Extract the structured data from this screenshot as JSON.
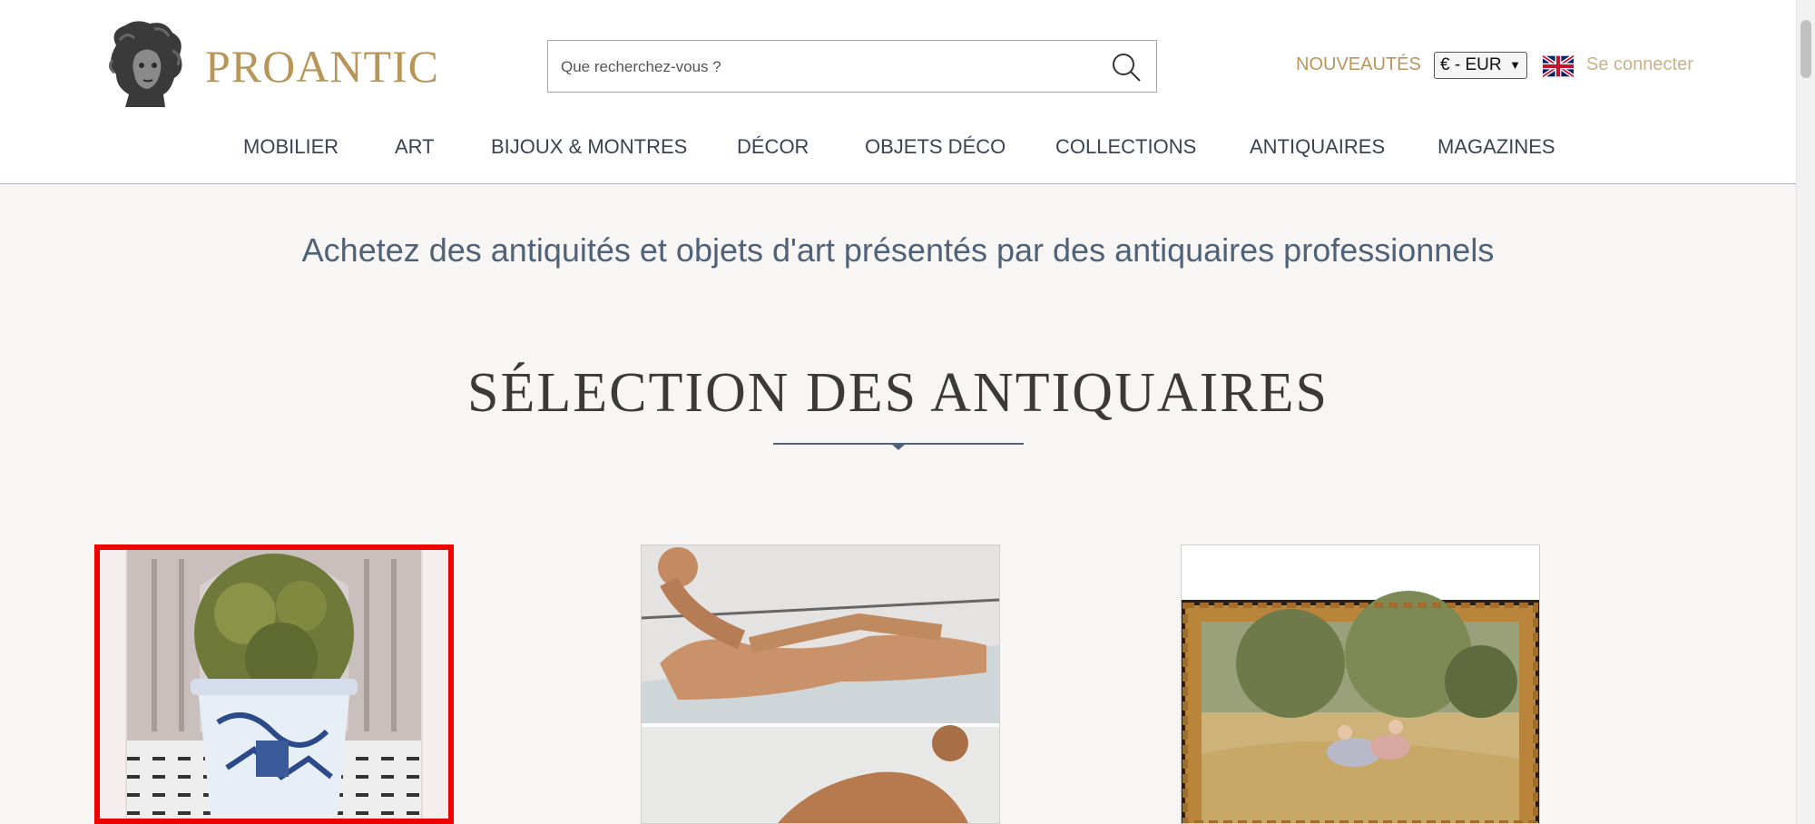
{
  "header": {
    "logo_text": "PROANTIC",
    "search": {
      "placeholder": "Que recherchez-vous ?",
      "value": ""
    },
    "nouveautes_label": "NOUVEAUTÉS",
    "currency": {
      "selected": "€ - EUR"
    },
    "language_flag": "uk-flag-icon",
    "login_label": "Se connecter"
  },
  "nav": {
    "items": [
      {
        "label": "MOBILIER"
      },
      {
        "label": "ART"
      },
      {
        "label": "BIJOUX & MONTRES"
      },
      {
        "label": "DÉCOR"
      },
      {
        "label": "OBJETS DÉCO"
      },
      {
        "label": "COLLECTIONS"
      },
      {
        "label": "ANTIQUAIRES"
      },
      {
        "label": "MAGAZINES"
      }
    ]
  },
  "main": {
    "tagline": "Achetez des antiquités et objets d'art présentés par des antiquaires professionnels",
    "section_title": "SÉLECTION DES ANTIQUAIRES"
  },
  "colors": {
    "brand_gold": "#b8965a",
    "nav_text": "#3b4250",
    "tagline": "#4f6278",
    "highlight_border": "#ee0000",
    "page_bg": "#f7f6f4"
  }
}
